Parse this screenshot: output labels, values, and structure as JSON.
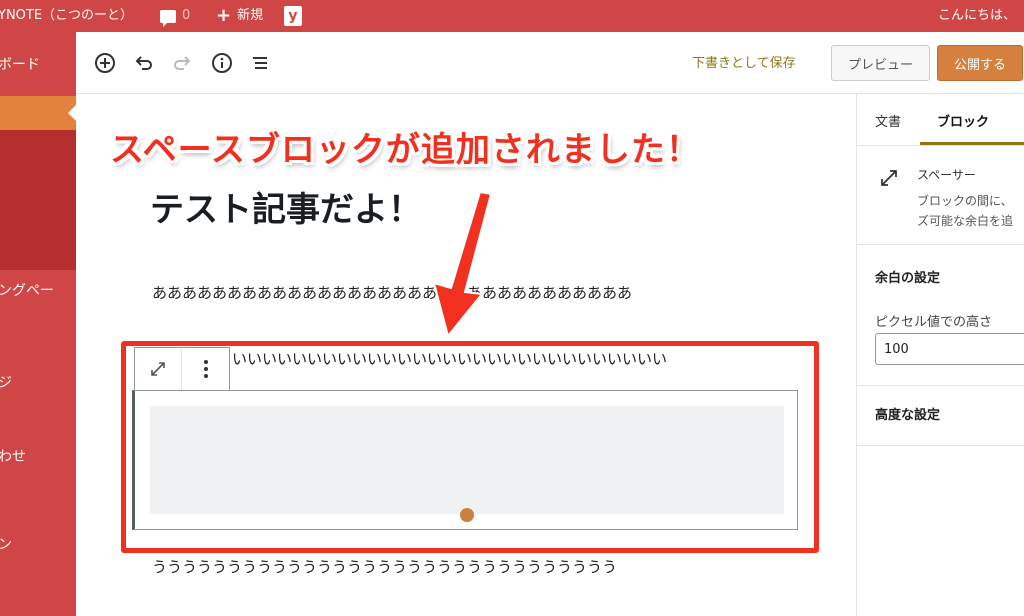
{
  "adminbar": {
    "site_name": "YNOTE（こつのーと）",
    "comments_count": "0",
    "new_label": "新規",
    "yoast_label": "y",
    "greeting": "こんにちは、"
  },
  "adminmenu": {
    "items": [
      {
        "label": "ボード"
      },
      {
        "label": "ングペー"
      },
      {
        "label": "ジ"
      },
      {
        "label": "わせ"
      },
      {
        "label": "ン"
      }
    ]
  },
  "header": {
    "save_draft": "下書きとして保存",
    "preview": "プレビュー",
    "publish": "公開する"
  },
  "sidebar": {
    "tabs": [
      {
        "label": "文書"
      },
      {
        "label": "ブロック"
      }
    ],
    "block_name": "スペーサー",
    "block_desc_line1": "ブロックの間に、",
    "block_desc_line2": "ズ可能な余白を追",
    "spacing_heading": "余白の設定",
    "height_label": "ピクセル値での高さ",
    "height_value": "100",
    "advanced_heading": "高度な設定"
  },
  "content": {
    "title": "テスト記事だよ！",
    "para_a": "ああああああああああああああああああああああああああああああああ",
    "para_i": "いいいいいいいいいいいいいいいいいいいいいいいいいいいいい",
    "para_u": "ううううううううううううううううううううううううううううううう"
  },
  "annotation": {
    "text": "スペースブロックが追加されました！",
    "color": "#f1301f"
  },
  "colors": {
    "admin_bar": "#d04545",
    "menu_current": "#e2823c",
    "publish": "#d5803f",
    "accent_text": "#8a7a1a"
  }
}
